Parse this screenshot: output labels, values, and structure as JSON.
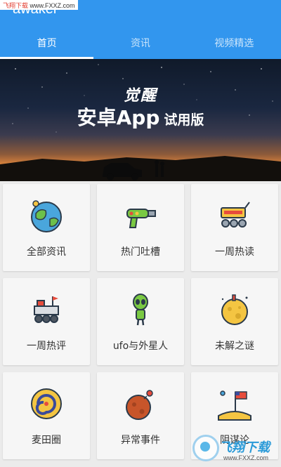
{
  "watermark_top": {
    "brand": "飞翔下载",
    "url": "www.FXXZ.com"
  },
  "app": {
    "title": "awakel"
  },
  "tabs": [
    {
      "label": "首页",
      "active": true
    },
    {
      "label": "资讯",
      "active": false
    },
    {
      "label": "视频精选",
      "active": false
    }
  ],
  "banner": {
    "logo": "觉醒",
    "title_main": "安卓App",
    "title_sub": "试用版"
  },
  "grid": [
    {
      "label": "全部资讯",
      "icon": "earth-icon"
    },
    {
      "label": "热门吐槽",
      "icon": "ray-gun-icon"
    },
    {
      "label": "一周热读",
      "icon": "rover-icon"
    },
    {
      "label": "一周热评",
      "icon": "lunar-rover-icon"
    },
    {
      "label": "ufo与外星人",
      "icon": "alien-icon"
    },
    {
      "label": "未解之谜",
      "icon": "moon-icon"
    },
    {
      "label": "麦田圈",
      "icon": "galaxy-icon"
    },
    {
      "label": "异常事件",
      "icon": "meteor-icon"
    },
    {
      "label": "阴谋论",
      "icon": "moon-flag-icon"
    }
  ],
  "watermark_bottom": {
    "brand": "飞翔下载",
    "url": "www.FXXZ.com"
  },
  "colors": {
    "header": "#3296ee",
    "card": "#f6f6f6",
    "background": "#ebebeb"
  }
}
